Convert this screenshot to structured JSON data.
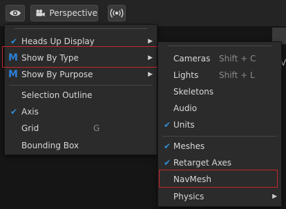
{
  "toolbar": {
    "eye_icon": "eye-icon",
    "camera_icon": "movie-camera-icon",
    "perspective_label": "Perspective",
    "audio_icon": "audio-broadcast-icon"
  },
  "right_edge_letter": "V",
  "main_menu": {
    "items": [
      {
        "label": "Heads Up Display",
        "checked": true,
        "submenu": true
      },
      {
        "label": "Show By Type",
        "icon": "M",
        "submenu": true,
        "highlighted": true
      },
      {
        "label": "Show By Purpose",
        "icon": "M",
        "submenu": true
      },
      {
        "label": "Selection Outline"
      },
      {
        "label": "Axis",
        "checked": true
      },
      {
        "label": "Grid",
        "shortcut": "G"
      },
      {
        "label": "Bounding Box"
      }
    ]
  },
  "sub_menu": {
    "items": [
      {
        "label": "Cameras",
        "shortcut": "Shift + C"
      },
      {
        "label": "Lights",
        "shortcut": "Shift + L"
      },
      {
        "label": "Skeletons"
      },
      {
        "label": "Audio"
      },
      {
        "label": "Units",
        "checked": true
      },
      {
        "label": "Meshes",
        "checked": true
      },
      {
        "label": "Retarget Axes",
        "checked": true
      },
      {
        "label": "NavMesh",
        "highlighted": true
      },
      {
        "label": "Physics",
        "submenu": true
      }
    ]
  },
  "colors": {
    "check": "#2f8fd8",
    "logo": "#2b7fd6",
    "highlight_border": "#c8252b",
    "menu_bg": "#2b2b2b"
  }
}
